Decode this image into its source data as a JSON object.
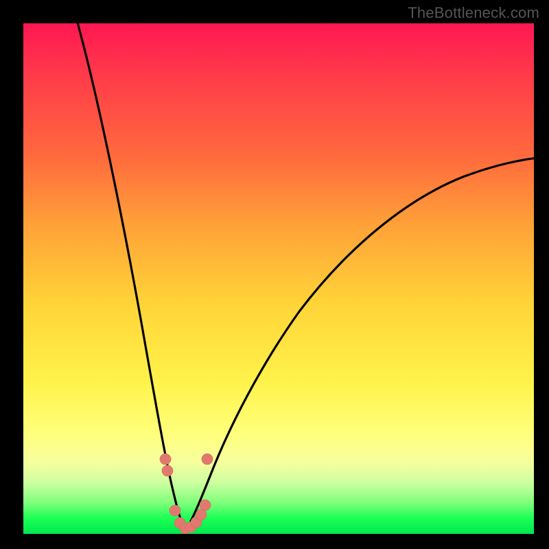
{
  "watermark": "TheBottleneck.com",
  "colors": {
    "page_bg": "#000000",
    "black_frame": "#000000",
    "curve_stroke": "#000000",
    "marker_fill": "#e2796e",
    "gradient_stops": [
      "#ff1752",
      "#ff3a4a",
      "#ff6a3d",
      "#ffa338",
      "#ffd438",
      "#fff24a",
      "#ffff79",
      "#f6ff9e",
      "#ccffa0",
      "#7cff7a",
      "#1bff55",
      "#00e84e"
    ]
  },
  "chart_data": {
    "type": "line",
    "title": "",
    "xlabel": "",
    "ylabel": "",
    "x_range": [
      0,
      100
    ],
    "y_range": [
      0,
      100
    ],
    "note": "y = bottleneck percentage (0 green bottom, 100 red top). V-shaped curve; minimum near x≈31, y≈0. Left branch steep, right branch shallower asymptotic.",
    "series": [
      {
        "name": "left-branch",
        "x": [
          10,
          14,
          18,
          22,
          24,
          26,
          28,
          29.5,
          31
        ],
        "y": [
          100,
          85,
          67,
          47,
          36,
          25,
          12,
          4,
          0
        ]
      },
      {
        "name": "right-branch",
        "x": [
          31,
          33,
          35,
          38,
          42,
          48,
          55,
          63,
          72,
          82,
          92,
          100
        ],
        "y": [
          0,
          4,
          10,
          18,
          27,
          37,
          46,
          54,
          60,
          65,
          68.5,
          71
        ]
      }
    ],
    "markers": {
      "name": "highlighted-points",
      "color": "#e2796e",
      "points": [
        {
          "x": 27.5,
          "y": 13.5
        },
        {
          "x": 27.8,
          "y": 11.5
        },
        {
          "x": 29.0,
          "y": 3.0
        },
        {
          "x": 30.0,
          "y": 1.0
        },
        {
          "x": 31.0,
          "y": 0.5
        },
        {
          "x": 32.0,
          "y": 0.7
        },
        {
          "x": 33.0,
          "y": 1.5
        },
        {
          "x": 33.8,
          "y": 3.0
        },
        {
          "x": 34.7,
          "y": 5.5
        },
        {
          "x": 35.3,
          "y": 13.5
        }
      ]
    }
  }
}
